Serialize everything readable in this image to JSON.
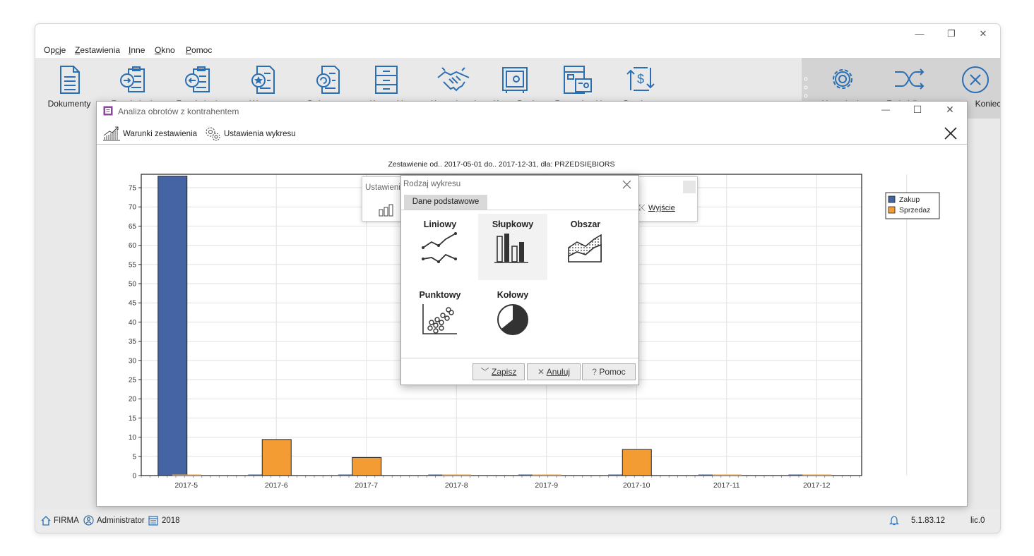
{
  "app": {
    "menu": [
      {
        "label": "Opcje",
        "u": "c"
      },
      {
        "label": "Zestawienia",
        "u": "Z"
      },
      {
        "label": "Inne",
        "u": "I"
      },
      {
        "label": "Okno",
        "u": "O"
      },
      {
        "label": "Pomoc",
        "u": "P"
      }
    ],
    "toolbar": [
      {
        "label": "Dokumenty",
        "icon": "document-icon"
      },
      {
        "label": "Zamówienia",
        "icon": "order-in-icon"
      },
      {
        "label": "Zamówienia",
        "icon": "order-out-icon"
      },
      {
        "label": "Wzorce",
        "icon": "template-icon"
      },
      {
        "label": "Dokumenty",
        "icon": "document-refresh-icon"
      },
      {
        "label": "Kartoteki",
        "icon": "cabinet-icon"
      },
      {
        "label": "Kontrahenci",
        "icon": "handshake-icon"
      },
      {
        "label": "Kasa, Bank",
        "icon": "safe-icon"
      },
      {
        "label": "Rozrachunki",
        "icon": "settlements-icon"
      },
      {
        "label": "Przelewy",
        "icon": "transfer-icon"
      }
    ],
    "toolbar_right": [
      {
        "label": "Ustawienia",
        "icon": "gear-icon"
      },
      {
        "label": "Zmień firmę",
        "icon": "shuffle-icon"
      },
      {
        "label": "Koniec",
        "icon": "close-circle-icon"
      }
    ],
    "status": {
      "firm": "FIRMA",
      "user": "Administrator",
      "year": "2018",
      "version": "5.1.83.12",
      "license": "lic.0"
    }
  },
  "window": {
    "title": "Analiza obrotów z kontrahentem",
    "tool_conditions": "Warunki zestawienia",
    "tool_chart_settings": "Ustawienia wykresu"
  },
  "chart_data": {
    "type": "bar",
    "title": "Zestawienie od.. 2017-05-01  do.. 2017-12-31, dla: PRZEDSIĘBIORS",
    "categories": [
      "2017-5",
      "2017-6",
      "2017-7",
      "2017-8",
      "2017-9",
      "2017-10",
      "2017-11",
      "2017-12"
    ],
    "series": [
      {
        "name": "Zakup",
        "color": "#4464a4",
        "values": [
          78,
          0,
          0,
          0,
          0,
          0,
          0,
          0
        ]
      },
      {
        "name": "Sprzedaz",
        "color": "#f39c34",
        "values": [
          0,
          9.4,
          4.7,
          0,
          0,
          6.8,
          0,
          0
        ]
      }
    ],
    "yticks": [
      0,
      5,
      10,
      15,
      20,
      25,
      30,
      35,
      40,
      45,
      50,
      55,
      60,
      65,
      70,
      75
    ],
    "ylim": [
      0,
      78.5
    ],
    "grid": true,
    "legend": "top-right"
  },
  "back_dialog": {
    "title": "Ustawienia",
    "exit_label": "Wyjście"
  },
  "dialog": {
    "title": "Rodzaj wykresu",
    "tab": "Dane podstawowe",
    "types": [
      {
        "label": "Liniowy",
        "icon": "line-chart-icon"
      },
      {
        "label": "Słupkowy",
        "icon": "bar-chart-icon",
        "selected": true
      },
      {
        "label": "Obszar",
        "icon": "area-chart-icon"
      },
      {
        "label": "Punktowy",
        "icon": "scatter-chart-icon"
      },
      {
        "label": "Kołowy",
        "icon": "pie-chart-icon"
      }
    ],
    "save_label": "Zapisz",
    "cancel_label": "Anuluj",
    "help_label": "Pomoc"
  }
}
